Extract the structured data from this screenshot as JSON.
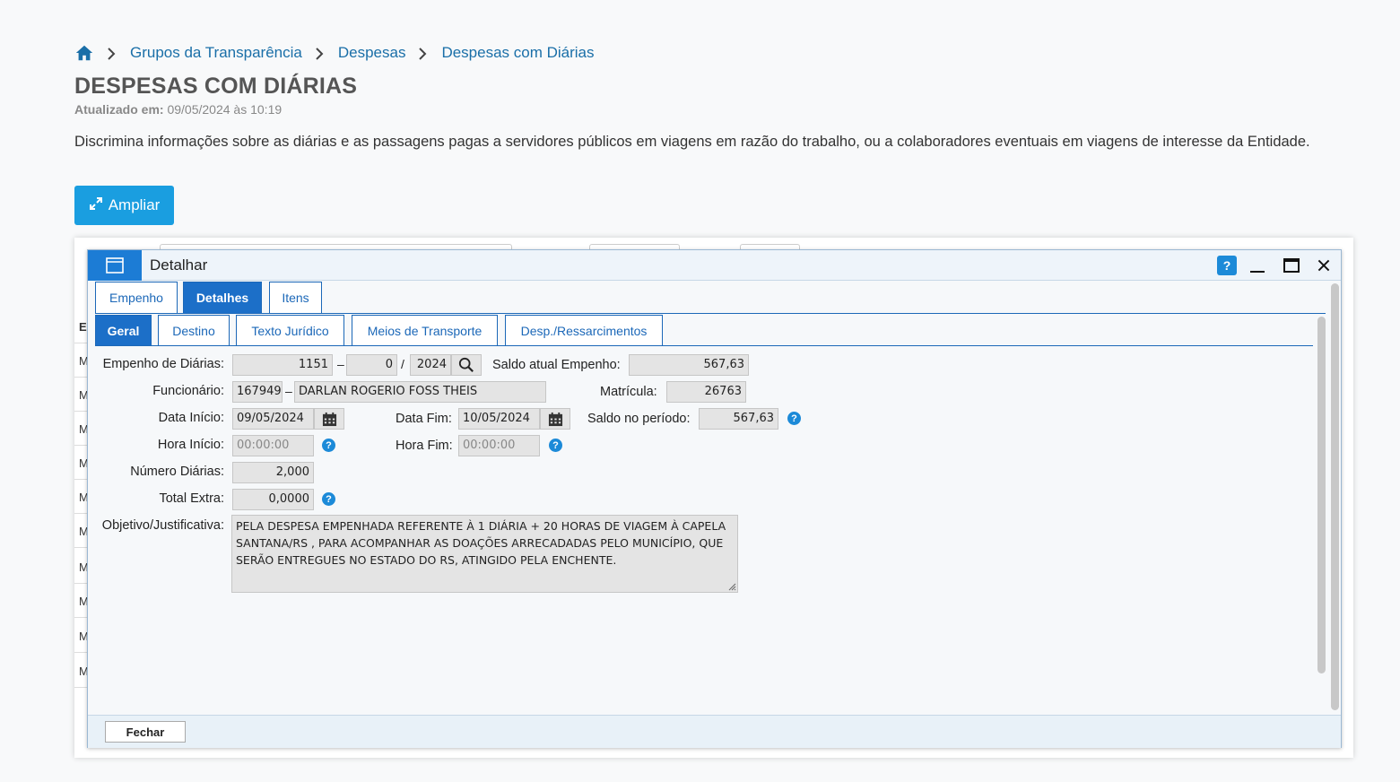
{
  "breadcrumb": {
    "items": [
      "Grupos da Transparência",
      "Despesas",
      "Despesas com Diárias"
    ]
  },
  "page": {
    "title": "DESPESAS COM DIÁRIAS",
    "updated_label": "Atualizado em:",
    "updated_value": "09/05/2024 às 10:19",
    "description": "Discrimina informações sobre as diárias e as passagens pagas a servidores públicos em viagens em razão do trabalho, ou a colaboradores eventuais em viagens de interesse da Entidade.",
    "ampliar_label": "Ampliar"
  },
  "background_table": {
    "first_col": [
      "E",
      "M",
      "M",
      "M",
      "M",
      "M",
      "M",
      "M",
      "M",
      "M",
      "M"
    ]
  },
  "dialog": {
    "title": "Detalhar",
    "help_label": "?",
    "tabs": [
      {
        "label": "Empenho",
        "active": false
      },
      {
        "label": "Detalhes",
        "active": true
      },
      {
        "label": "Itens",
        "active": false
      }
    ],
    "subtabs": [
      {
        "label": "Geral",
        "active": true
      },
      {
        "label": "Destino",
        "active": false
      },
      {
        "label": "Texto Jurídico",
        "active": false
      },
      {
        "label": "Meios de Transporte",
        "active": false
      },
      {
        "label": "Desp./Ressarcimentos",
        "active": false
      }
    ],
    "form": {
      "empenho_label": "Empenho de Diárias:",
      "empenho_num": "1151",
      "empenho_sub": "0",
      "empenho_ano": "2024",
      "saldo_atual_label": "Saldo atual Empenho:",
      "saldo_atual": "567,63",
      "funcionario_label": "Funcionário:",
      "funcionario_id": "167949",
      "funcionario_nome": "DARLAN ROGERIO FOSS THEIS",
      "matricula_label": "Matrícula:",
      "matricula": "26763",
      "data_inicio_label": "Data Início:",
      "data_inicio": "09/05/2024",
      "data_fim_label": "Data Fim:",
      "data_fim": "10/05/2024",
      "saldo_periodo_label": "Saldo no período:",
      "saldo_periodo": "567,63",
      "hora_inicio_label": "Hora Início:",
      "hora_inicio": "00:00:00",
      "hora_fim_label": "Hora Fim:",
      "hora_fim": "00:00:00",
      "numero_diarias_label": "Número Diárias:",
      "numero_diarias": "2,000",
      "total_extra_label": "Total Extra:",
      "total_extra": "0,0000",
      "objetivo_label": "Objetivo/Justificativa:",
      "objetivo": "PELA DESPESA EMPENHADA REFERENTE À 1 DIÁRIA + 20 HORAS DE  VIAGEM À CAPELA SANTANA/RS ,  PARA  ACOMPANHAR AS DOAÇÕES ARRECADADAS PELO MUNICÍPIO, QUE SERÃO ENTREGUES NO ESTADO DO RS, ATINGIDO PELA ENCHENTE."
    },
    "fechar_label": "Fechar"
  },
  "colors": {
    "link": "#1a6fa8",
    "primary_button": "#1a9ee0",
    "tab_active": "#1c6fc8",
    "dialog_icon_bg": "#1c7cd5"
  }
}
